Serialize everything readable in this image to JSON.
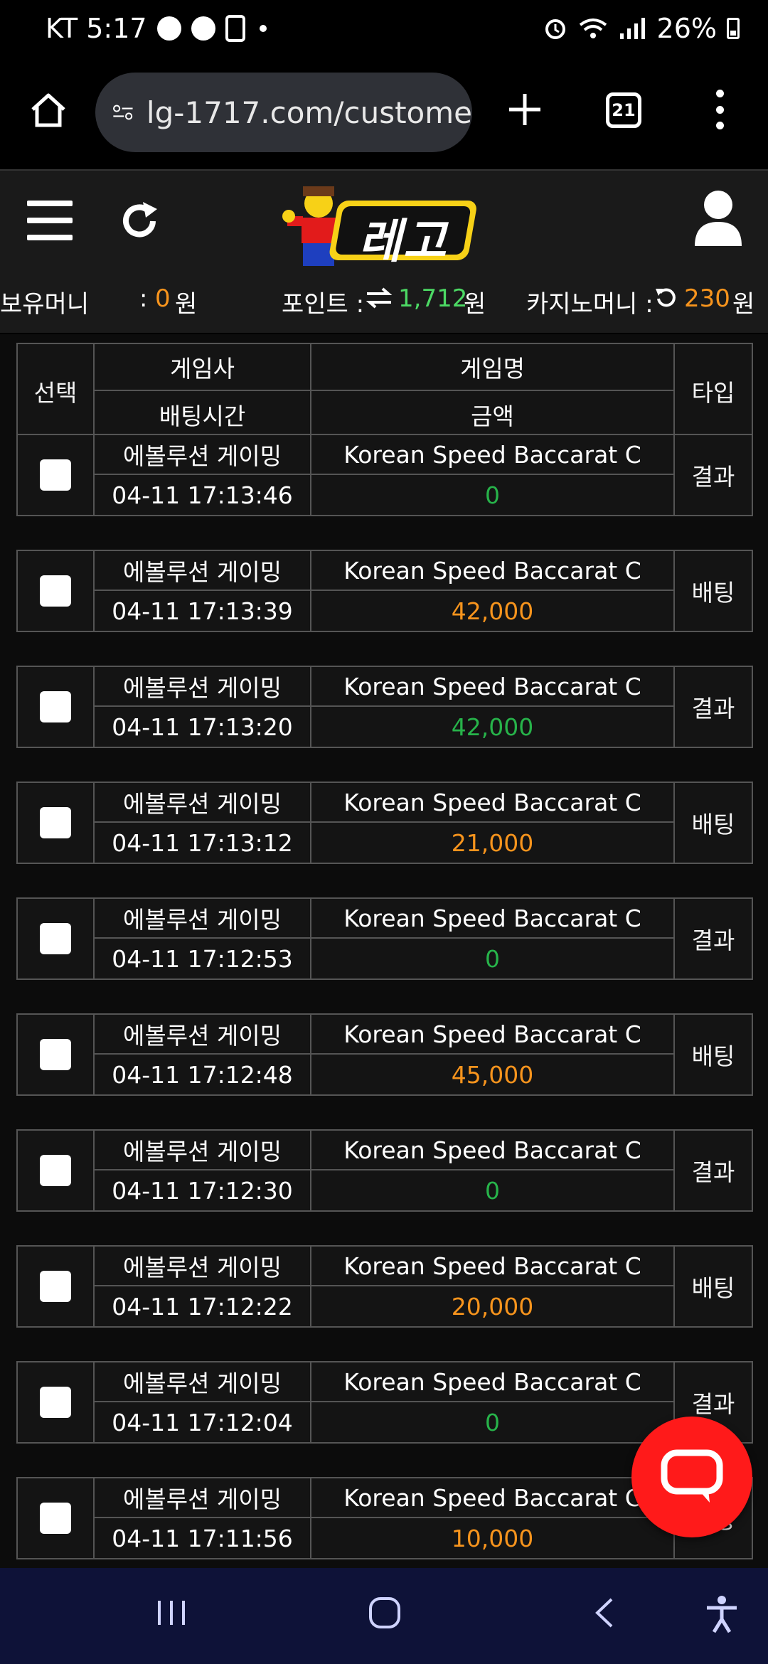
{
  "status": {
    "carrier_time": "KT 5:17",
    "battery": "26%"
  },
  "browser": {
    "url": "lg-1717.com/custome",
    "tab_count": "21"
  },
  "site": {
    "logo_text": "레고",
    "balance": {
      "money_label": "보유머니",
      "money_sep": ":",
      "money_value": "0",
      "money_unit": "원",
      "point_label": "포인트 :",
      "point_value": "1,712",
      "point_unit": "원",
      "casino_label": "카지노머니 :",
      "casino_value": "230",
      "casino_unit": "원"
    }
  },
  "table": {
    "headers": {
      "select": "선택",
      "provider": "게임사",
      "bet_time": "배팅시간",
      "game_name": "게임명",
      "amount": "금액",
      "type": "타입"
    },
    "rows": [
      {
        "provider": "에볼루션 게이밍",
        "time": "04-11 17:13:46",
        "game": "Korean Speed Baccarat C",
        "amount": "0",
        "amount_color": "green",
        "type": "결과"
      },
      {
        "provider": "에볼루션 게이밍",
        "time": "04-11 17:13:39",
        "game": "Korean Speed Baccarat C",
        "amount": "42,000",
        "amount_color": "orange",
        "type": "배팅"
      },
      {
        "provider": "에볼루션 게이밍",
        "time": "04-11 17:13:20",
        "game": "Korean Speed Baccarat C",
        "amount": "42,000",
        "amount_color": "green",
        "type": "결과"
      },
      {
        "provider": "에볼루션 게이밍",
        "time": "04-11 17:13:12",
        "game": "Korean Speed Baccarat C",
        "amount": "21,000",
        "amount_color": "orange",
        "type": "배팅"
      },
      {
        "provider": "에볼루션 게이밍",
        "time": "04-11 17:12:53",
        "game": "Korean Speed Baccarat C",
        "amount": "0",
        "amount_color": "green",
        "type": "결과"
      },
      {
        "provider": "에볼루션 게이밍",
        "time": "04-11 17:12:48",
        "game": "Korean Speed Baccarat C",
        "amount": "45,000",
        "amount_color": "orange",
        "type": "배팅"
      },
      {
        "provider": "에볼루션 게이밍",
        "time": "04-11 17:12:30",
        "game": "Korean Speed Baccarat C",
        "amount": "0",
        "amount_color": "green",
        "type": "결과"
      },
      {
        "provider": "에볼루션 게이밍",
        "time": "04-11 17:12:22",
        "game": "Korean Speed Baccarat C",
        "amount": "20,000",
        "amount_color": "orange",
        "type": "배팅"
      },
      {
        "provider": "에볼루션 게이밍",
        "time": "04-11 17:12:04",
        "game": "Korean Speed Baccarat C",
        "amount": "0",
        "amount_color": "green",
        "type": "결과"
      },
      {
        "provider": "에볼루션 게이밍",
        "time": "04-11 17:11:56",
        "game": "Korean Speed Baccarat C",
        "amount": "10,000",
        "amount_color": "orange",
        "type": "배팅"
      }
    ]
  },
  "colors": {
    "green": "#27b34a",
    "orange": "#f7941d",
    "chat": "#ff1a1a",
    "navbar": "#0e1238"
  }
}
